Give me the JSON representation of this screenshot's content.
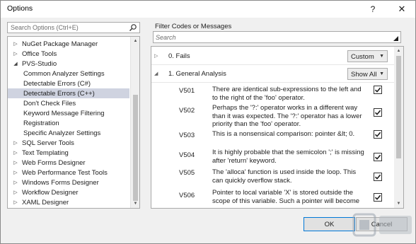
{
  "window": {
    "title": "Options",
    "help_glyph": "?",
    "close_glyph": "✕"
  },
  "left": {
    "search_placeholder": "Search Options (Ctrl+E)",
    "tree": [
      {
        "label": "NuGet Package Manager",
        "arrow": "▷",
        "level": 0
      },
      {
        "label": "Office Tools",
        "arrow": "▷",
        "level": 0
      },
      {
        "label": "PVS-Studio",
        "arrow": "◢",
        "level": 0
      },
      {
        "label": "Common Analyzer Settings",
        "arrow": "",
        "level": 1
      },
      {
        "label": "Detectable Errors (C#)",
        "arrow": "",
        "level": 1
      },
      {
        "label": "Detectable Errors (C++)",
        "arrow": "",
        "level": 1,
        "selected": true
      },
      {
        "label": "Don't Check Files",
        "arrow": "",
        "level": 1
      },
      {
        "label": "Keyword Message Filtering",
        "arrow": "",
        "level": 1
      },
      {
        "label": "Registration",
        "arrow": "",
        "level": 1
      },
      {
        "label": "Specific Analyzer Settings",
        "arrow": "",
        "level": 1
      },
      {
        "label": "SQL Server Tools",
        "arrow": "▷",
        "level": 0
      },
      {
        "label": "Text Templating",
        "arrow": "▷",
        "level": 0
      },
      {
        "label": "Web Forms Designer",
        "arrow": "▷",
        "level": 0
      },
      {
        "label": "Web Performance Test Tools",
        "arrow": "▷",
        "level": 0
      },
      {
        "label": "Windows Forms Designer",
        "arrow": "▷",
        "level": 0
      },
      {
        "label": "Workflow Designer",
        "arrow": "▷",
        "level": 0
      },
      {
        "label": "XAML Designer",
        "arrow": "▷",
        "level": 0
      }
    ]
  },
  "right": {
    "filter_label": "Filter Codes or Messages",
    "search_placeholder": "Search",
    "groups": [
      {
        "name": "0. Fails",
        "expander": "▷",
        "combo": "Custom"
      },
      {
        "name": "1. General Analysis",
        "expander": "◢",
        "combo": "Show All"
      }
    ],
    "errors": [
      {
        "code": "V501",
        "text": "There are identical sub-expressions to the left and to the right of the 'foo' operator.",
        "checked": true
      },
      {
        "code": "V502",
        "text": "Perhaps the '?:' operator works in a different way than it was expected. The '?:' operator has a lower priority than the 'foo' operator.",
        "checked": true
      },
      {
        "code": "V503",
        "text": "This is a nonsensical comparison: pointer &lt; 0.",
        "checked": true
      },
      {
        "code": "V504",
        "text": "It is highly probable that the semicolon ';' is missing after 'return' keyword.",
        "checked": true
      },
      {
        "code": "V505",
        "text": "The 'alloca' function is used inside the loop. This can quickly overflow stack.",
        "checked": true
      },
      {
        "code": "V506",
        "text": "Pointer to local variable 'X' is stored outside the scope of this variable. Such a pointer will become",
        "checked": true
      }
    ]
  },
  "buttons": {
    "ok": "OK",
    "cancel": "Cancel"
  },
  "colors": {
    "selected_bg": "#cfd3e0",
    "accent": "#0078d7"
  }
}
